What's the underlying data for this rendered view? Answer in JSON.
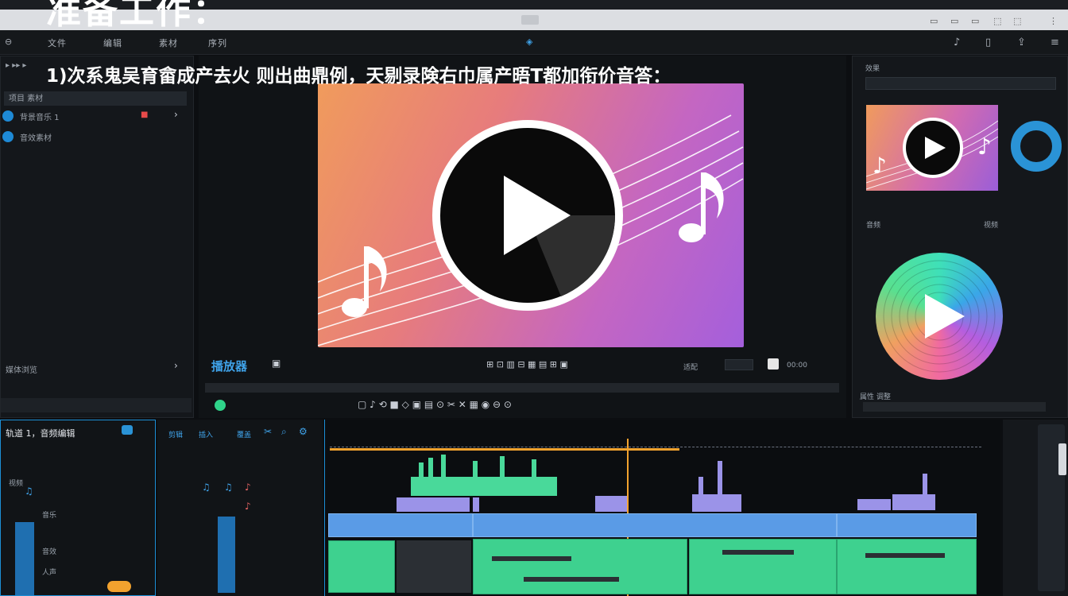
{
  "hero_title": "准备工作：",
  "caption": "1)次系鬼吴育畲成产去火 则出曲鼎例，天剔录険右巾属产晤T都加衔价音答：",
  "menu": [
    "文件",
    "编辑",
    "素材",
    "序列"
  ],
  "left_panel": {
    "header": "项目 素材",
    "items": [
      "背景音乐 1",
      "音效素材"
    ],
    "footer": "媒体浏览"
  },
  "viewer": {
    "toolbar_label": "播放器",
    "zoom": "适配",
    "timecode": "00:00"
  },
  "right_panel": {
    "header": "效果",
    "section1": "音频",
    "section2": "视频",
    "footer": "属性 调整"
  },
  "tracks": {
    "header": "轨道 1，音频编辑",
    "row_labels": [
      "视频",
      "音乐",
      "音效",
      "人声"
    ],
    "mid_header": [
      "剪辑",
      "插入",
      "覆盖"
    ]
  },
  "icons": [
    "play-icon",
    "music-note-icon",
    "scissor-icon",
    "gear-icon",
    "search-icon"
  ],
  "colors": {
    "accent": "#1e8ad6",
    "playhead": "#f2a22e",
    "waveform": "#49d99a",
    "clip_blue": "#5a9be6"
  }
}
